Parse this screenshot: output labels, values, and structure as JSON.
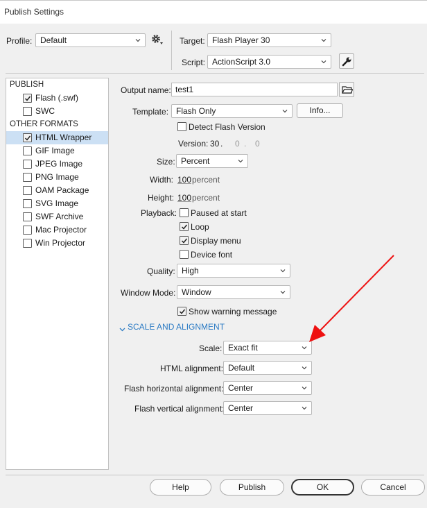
{
  "window": {
    "title": "Publish Settings"
  },
  "profile": {
    "label": "Profile:",
    "value": "Default"
  },
  "target": {
    "label": "Target:",
    "value": "Flash Player 30"
  },
  "script": {
    "label": "Script:",
    "value": "ActionScript 3.0"
  },
  "sidebar": {
    "publish_header": "PUBLISH",
    "other_header": "OTHER FORMATS",
    "publish_items": [
      {
        "label": "Flash (.swf)",
        "checked": true
      },
      {
        "label": "SWC",
        "checked": false
      }
    ],
    "other_items": [
      {
        "label": "HTML Wrapper",
        "checked": true,
        "selected": true
      },
      {
        "label": "GIF Image",
        "checked": false
      },
      {
        "label": "JPEG Image",
        "checked": false
      },
      {
        "label": "PNG Image",
        "checked": false
      },
      {
        "label": "OAM Package",
        "checked": false
      },
      {
        "label": "SVG Image",
        "checked": false
      },
      {
        "label": "SWF Archive",
        "checked": false
      },
      {
        "label": "Mac Projector",
        "checked": false
      },
      {
        "label": "Win Projector",
        "checked": false
      }
    ]
  },
  "main": {
    "output_name": {
      "label": "Output name:",
      "value": "test1"
    },
    "template": {
      "label": "Template:",
      "value": "Flash Only",
      "info_button": "Info..."
    },
    "detect_flash": {
      "label": "Detect Flash Version",
      "checked": false
    },
    "version": {
      "label": "Version:",
      "major": "30",
      "dot1": ".",
      "minor": "0",
      "dot2": ".",
      "patch": "0"
    },
    "size": {
      "label": "Size:",
      "value": "Percent"
    },
    "width": {
      "label": "Width:",
      "value": "100",
      "unit": "percent"
    },
    "height": {
      "label": "Height:",
      "value": "100",
      "unit": "percent"
    },
    "playback": {
      "label": "Playback:",
      "options": [
        {
          "label": "Paused at start",
          "checked": false
        },
        {
          "label": "Loop",
          "checked": true
        },
        {
          "label": "Display menu",
          "checked": true
        },
        {
          "label": "Device font",
          "checked": false
        }
      ]
    },
    "quality": {
      "label": "Quality:",
      "value": "High"
    },
    "window_mode": {
      "label": "Window Mode:",
      "value": "Window"
    },
    "show_warning": {
      "label": "Show warning message",
      "checked": true
    },
    "scale_section": {
      "label": "SCALE AND ALIGNMENT"
    },
    "scale": {
      "label": "Scale:",
      "value": "Exact fit"
    },
    "html_alignment": {
      "label": "HTML alignment:",
      "value": "Default"
    },
    "flash_h_align": {
      "label": "Flash horizontal alignment:",
      "value": "Center"
    },
    "flash_v_align": {
      "label": "Flash vertical alignment:",
      "value": "Center"
    }
  },
  "footer": {
    "help": "Help",
    "publish": "Publish",
    "ok": "OK",
    "cancel": "Cancel"
  },
  "colors": {
    "arrow": "#ee1111",
    "selection": "#cce0f4",
    "link": "#2c7bc4"
  }
}
